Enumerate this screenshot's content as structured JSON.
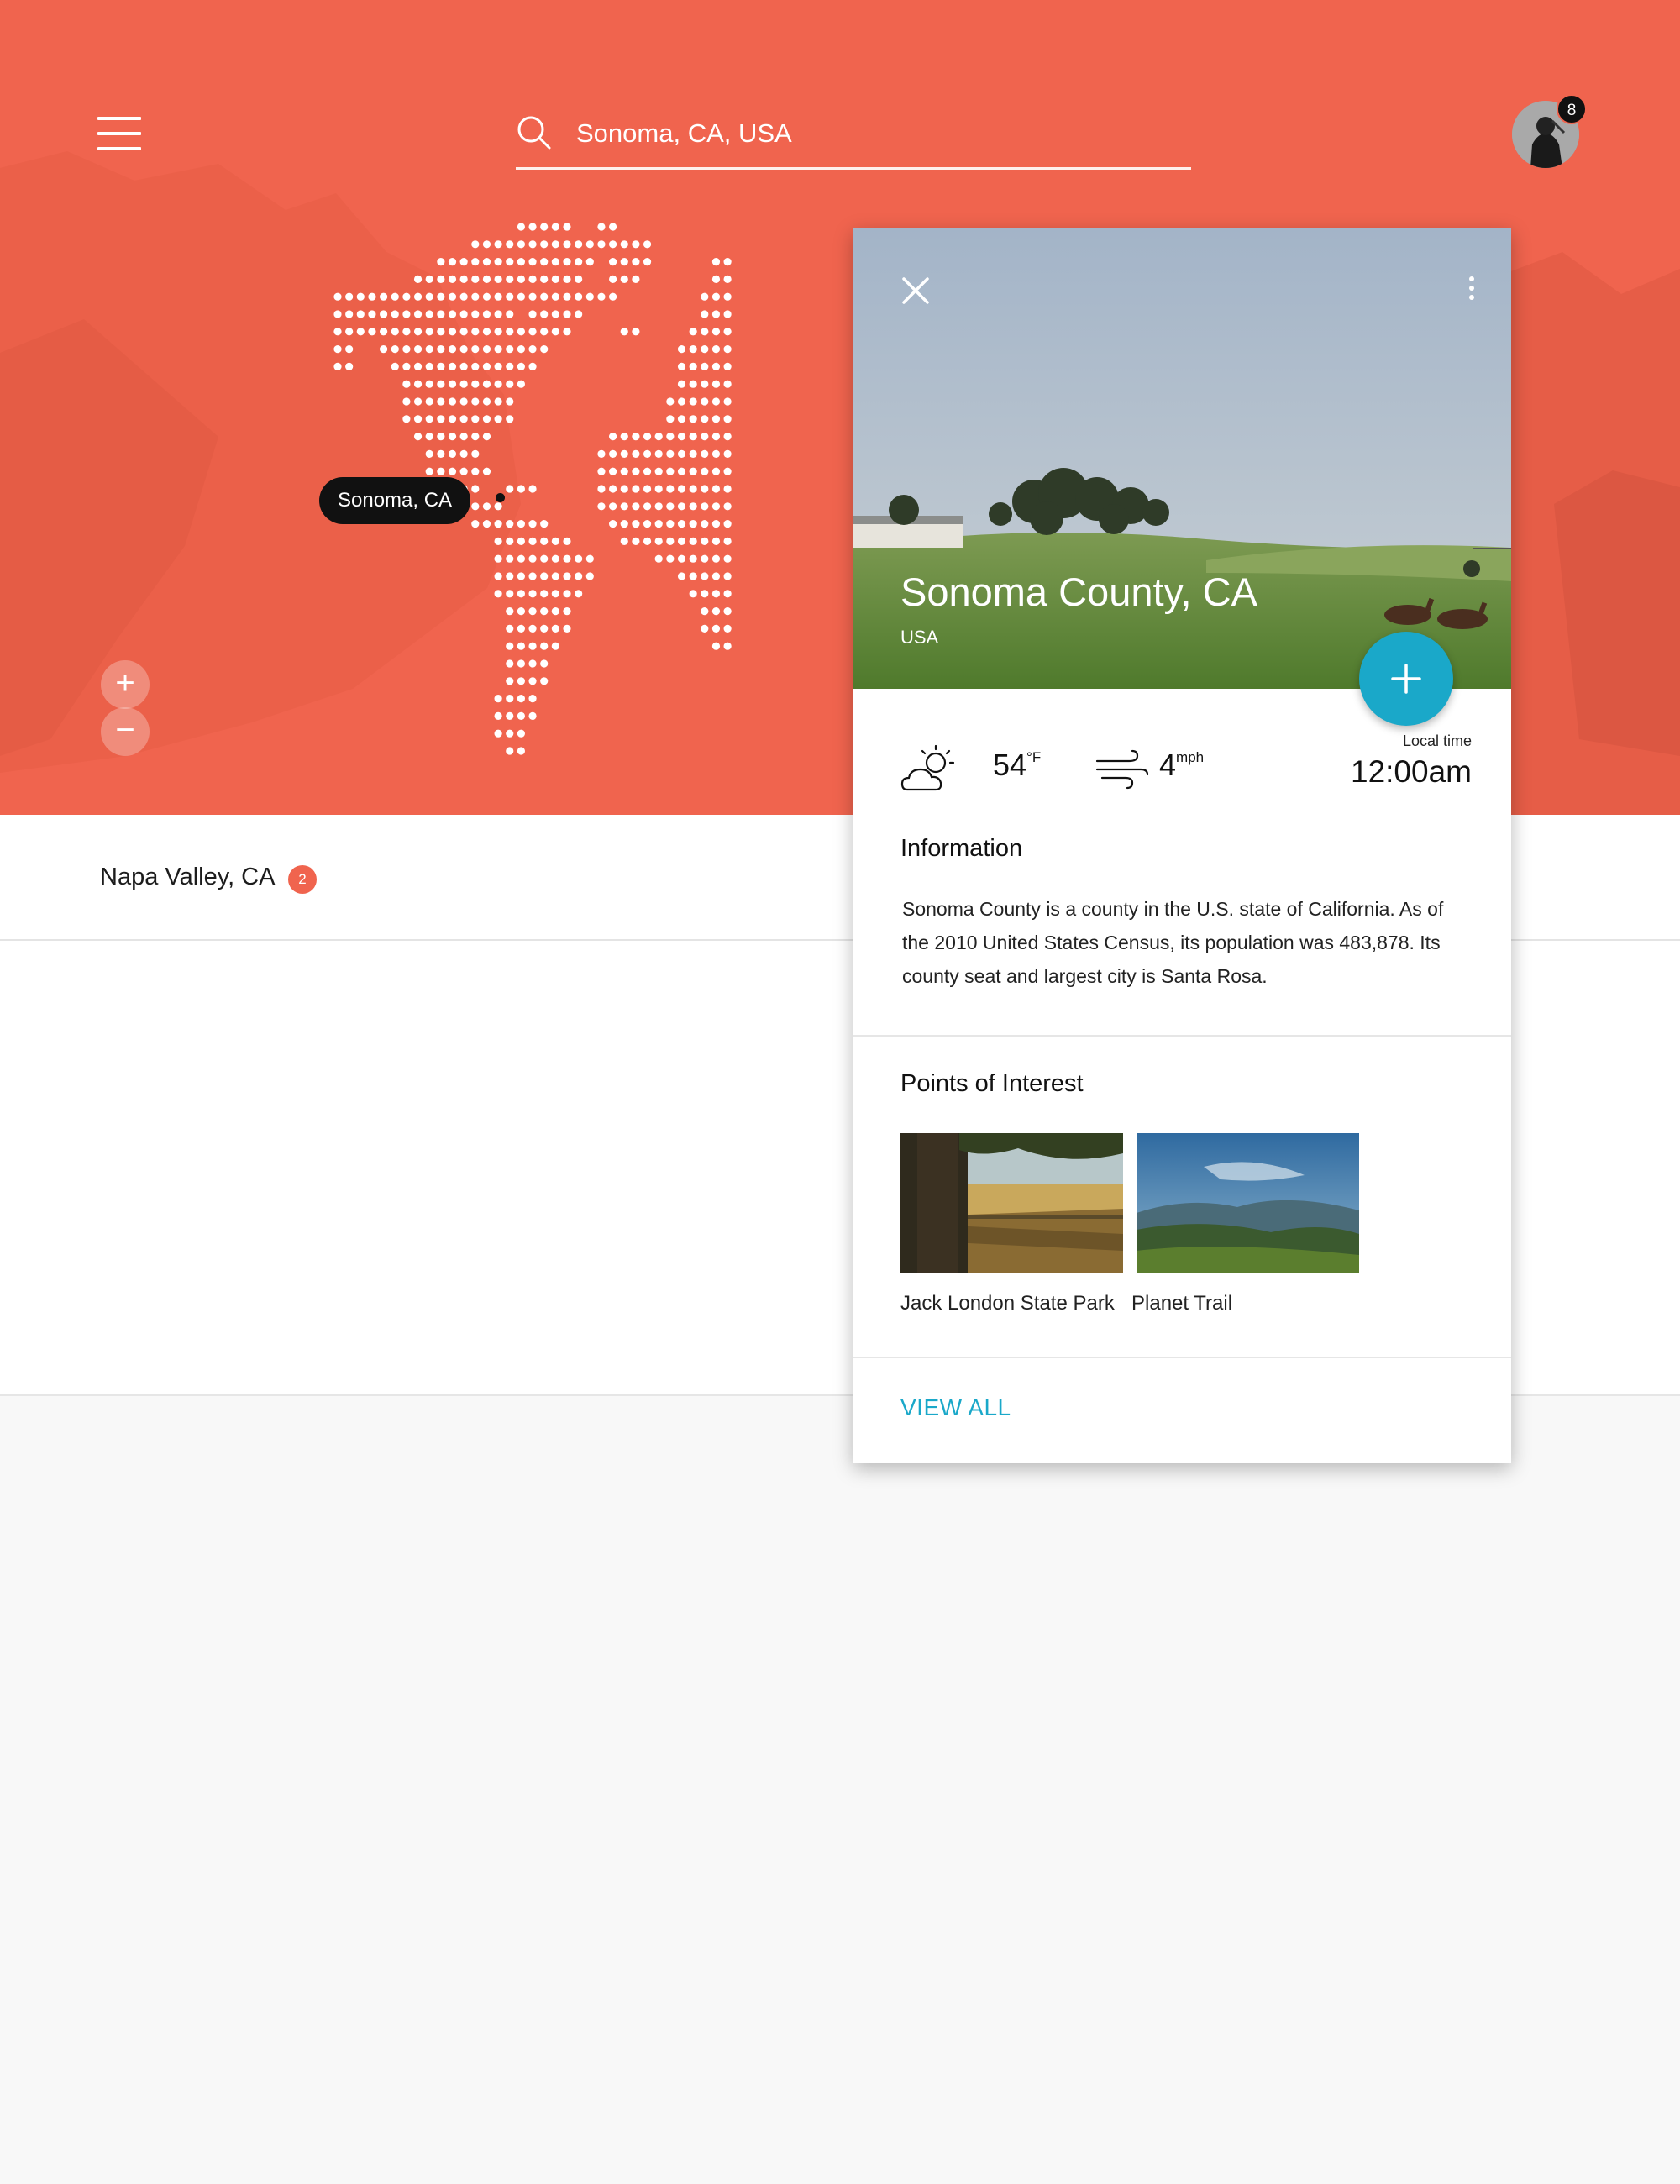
{
  "header": {
    "search": {
      "value": "Sonoma, CA, USA"
    },
    "notifications_count": "8"
  },
  "map": {
    "location_label": "Sonoma, CA",
    "zoom_in_label": "+",
    "zoom_out_label": "−"
  },
  "list": {
    "items": [
      {
        "label": "Napa Valley, CA",
        "badge": "2"
      }
    ]
  },
  "card": {
    "title": "Sonoma County, CA",
    "country": "USA",
    "weather": {
      "temperature": "54",
      "temperature_unit": "°F",
      "wind_speed": "4",
      "wind_unit": "mph",
      "local_time_label": "Local time",
      "local_time": "12:00am"
    },
    "information": {
      "heading": "Information",
      "text": "Sonoma County is a county in the U.S. state of California. As of the 2010 United States Census, its population was 483,878. Its county seat and largest city is Santa Rosa."
    },
    "points_of_interest": {
      "heading": "Points of Interest",
      "items": [
        {
          "label": "Jack London State Park"
        },
        {
          "label": "Planet Trail"
        }
      ],
      "view_all_label": "VIEW ALL"
    }
  },
  "colors": {
    "hero_background": "#f0644e",
    "accent": "#1aa8c9",
    "badge": "#f0644e"
  },
  "icons": [
    "menu-icon",
    "search-icon",
    "close-icon",
    "more-vert-icon",
    "add-icon",
    "partly-sunny-icon",
    "wind-icon"
  ]
}
